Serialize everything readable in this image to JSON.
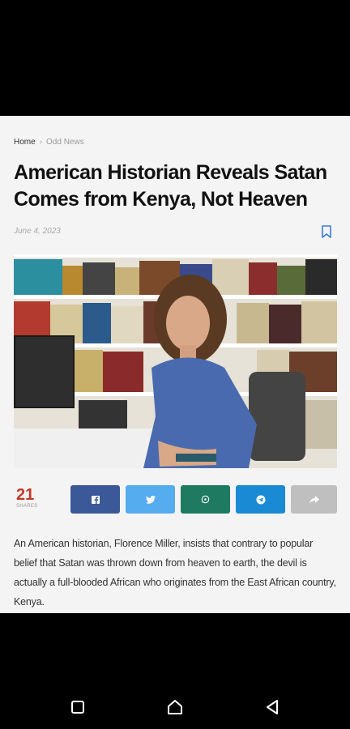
{
  "breadcrumb": {
    "home": "Home",
    "separator": "›",
    "category": "Odd News"
  },
  "article": {
    "headline": "American Historian Reveals Satan Comes from Kenya, Not Heaven",
    "date": "June 4, 2023",
    "image_description_icon": "photo",
    "excerpt": "An American historian, Florence Miller, insists that contrary to popular belief that Satan was thrown down from heaven to earth, the devil is actually a full-blooded African who originates from the East African country, Kenya."
  },
  "share": {
    "count": "21",
    "label": "SHARES",
    "buttons": [
      {
        "name": "facebook",
        "icon": "facebook-icon",
        "color": "#3b5998"
      },
      {
        "name": "twitter",
        "icon": "twitter-icon",
        "color": "#55acee"
      },
      {
        "name": "whatsapp",
        "icon": "whatsapp-icon",
        "color": "#1f7a62"
      },
      {
        "name": "telegram",
        "icon": "telegram-icon",
        "color": "#1a8ad4"
      },
      {
        "name": "share",
        "icon": "share-arrow-icon",
        "color": "#bfbfbf"
      }
    ]
  },
  "system_nav": {
    "recents": "square-icon",
    "home": "home-icon",
    "back": "back-triangle-icon"
  },
  "colors": {
    "accent": "#c0392b",
    "background": "#f4f4f4"
  }
}
